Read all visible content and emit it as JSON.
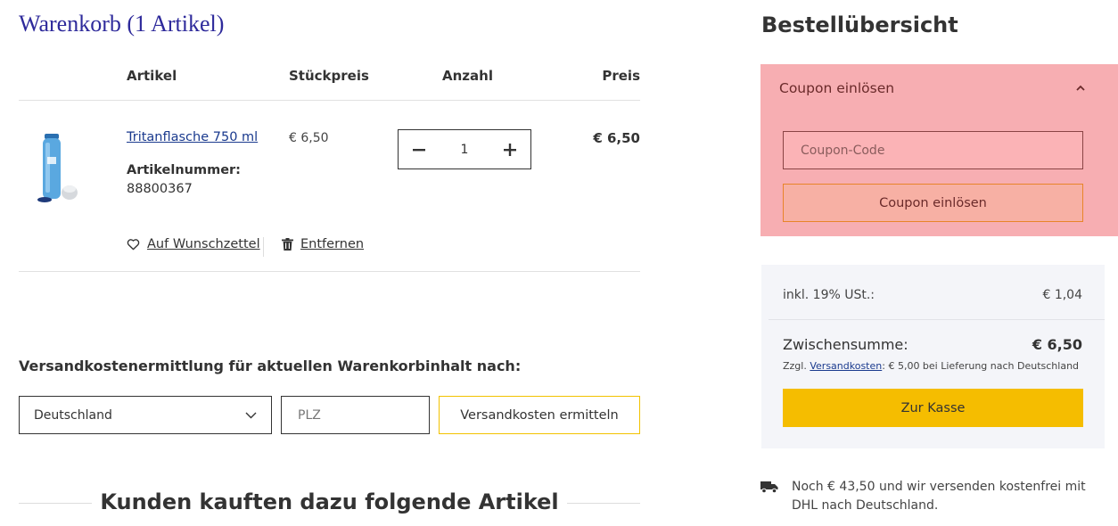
{
  "cart": {
    "title": "Warenkorb (1 Artikel)",
    "columns": {
      "article": "Artikel",
      "unit_price": "Stückpreis",
      "quantity": "Anzahl",
      "price": "Preis"
    },
    "item": {
      "name": "Tritanflasche 750 ml",
      "article_label": "Artikelnummer:",
      "article_number": "88800367",
      "unit_price": "€ 6,50",
      "quantity": "1",
      "price": "€ 6,50",
      "wishlist_label": "Auf Wunschzettel",
      "remove_label": "Entfernen"
    }
  },
  "shipping": {
    "title": "Versandkostenermittlung für aktuellen Warenkorbinhalt nach:",
    "country": "Deutschland",
    "plz_placeholder": "PLZ",
    "button_label": "Versandkosten ermitteln"
  },
  "recommendations": {
    "title": "Kunden kauften dazu folgende Artikel"
  },
  "summary": {
    "title": "Bestellübersicht",
    "coupon": {
      "header": "Coupon einlösen",
      "placeholder": "Coupon-Code",
      "button_label": "Coupon einlösen"
    },
    "tax_label": "inkl. 19% USt.:",
    "tax_value": "€ 1,04",
    "subtotal_label": "Zwischensumme:",
    "subtotal_value": "€ 6,50",
    "shipping_note_prefix": "Zzgl.",
    "shipping_note_link": "Versandkosten",
    "shipping_note_suffix": ": € 5,00 bei Lieferung nach Deutschland",
    "checkout_label": "Zur Kasse",
    "free_shipping_text": "Noch € 43,50 und wir versenden kostenfrei mit DHL nach Deutschland."
  },
  "colors": {
    "title_blue": "#2e2a9b",
    "link_blue": "#1a3a8e",
    "checkout_yellow": "#f5bd00",
    "coupon_highlight": "#f7aeb2"
  },
  "icons": [
    "bottle-product-image",
    "minus-icon",
    "plus-icon",
    "heart-icon",
    "trash-icon",
    "chevron-down-icon",
    "chevron-up-icon",
    "truck-icon"
  ]
}
